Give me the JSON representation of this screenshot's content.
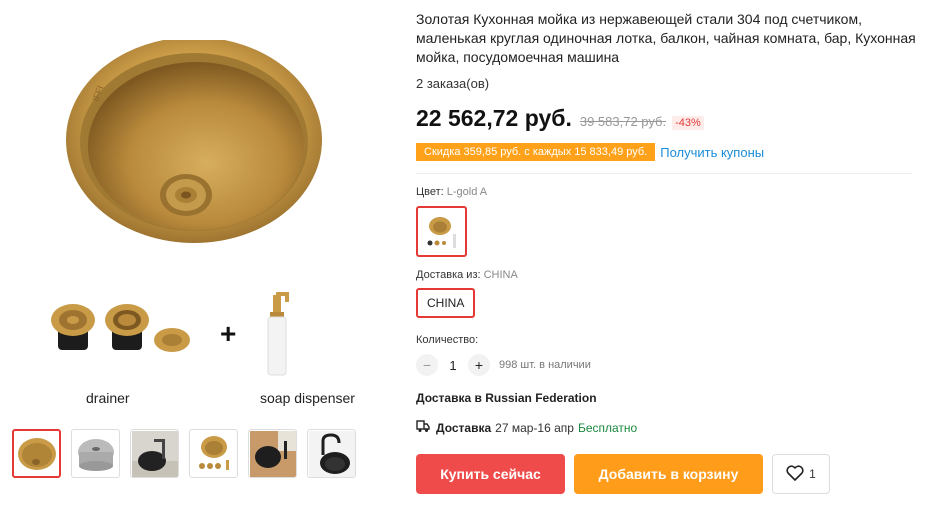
{
  "gallery": {
    "drainer_label": "drainer",
    "soap_label": "soap dispenser",
    "plus": "+",
    "thumbnails": [
      {
        "name": "thumb-gold-sink",
        "active": true
      },
      {
        "name": "thumb-gray-sink",
        "active": false
      },
      {
        "name": "thumb-black-sink-kitchen",
        "active": false
      },
      {
        "name": "thumb-gold-sink-kit",
        "active": false
      },
      {
        "name": "thumb-black-sink-wood",
        "active": false
      },
      {
        "name": "thumb-black-sink-faucet",
        "active": false
      }
    ]
  },
  "product": {
    "title": "Золотая Кухонная мойка из нержавеющей стали 304 под счетчиком, маленькая круглая одиночная лотка, балкон, чайная комната, бар, Кухонная мойка, посудомоечная машина",
    "orders": "2 заказа(ов)",
    "price": "22 562,72 руб.",
    "old_price": "39 583,72 руб.",
    "discount": "-43%",
    "coupon_badge": "Скидка 359,85 руб. с каждых 15 833,49 руб.",
    "coupon_link": "Получить купоны"
  },
  "options": {
    "color_label": "Цвет:",
    "color_value": "L-gold A",
    "ship_from_label": "Доставка из:",
    "ship_from_value": "CHINA",
    "ship_chip": "CHINA"
  },
  "quantity": {
    "label": "Количество:",
    "minus": "−",
    "value": "1",
    "plus": "+",
    "stock": "998 шт. в наличии"
  },
  "delivery": {
    "to": "Доставка в Russian Federation",
    "bold": "Доставка",
    "dates": "27 мар-16 апр",
    "free": "Бесплатно"
  },
  "actions": {
    "buy": "Купить сейчас",
    "cart": "Добавить в корзину",
    "wish_count": "1"
  },
  "colors": {
    "accent_red": "#f04b4b",
    "accent_orange": "#ff9c1a",
    "link_blue": "#1a8cd8",
    "free_green": "#1a8a3f",
    "gold": "#c9a04a"
  }
}
